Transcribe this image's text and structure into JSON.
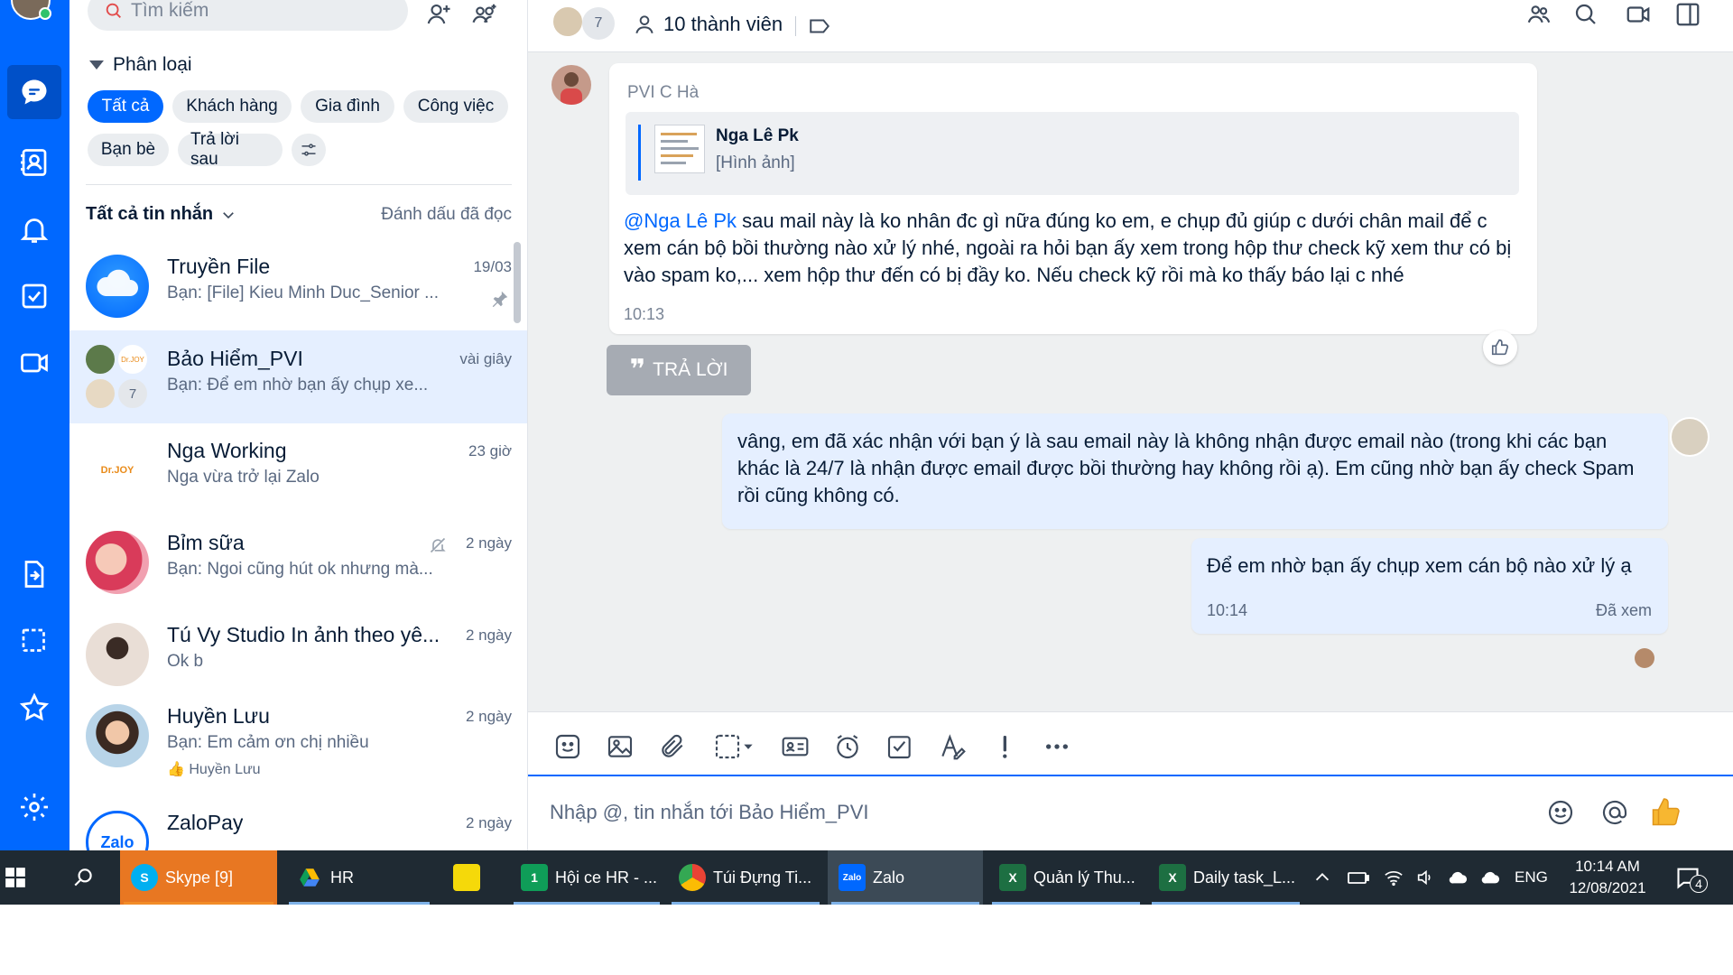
{
  "nav": {
    "items": [
      "chat-icon",
      "contacts-icon",
      "bell-icon",
      "todo-icon",
      "video-icon",
      "file-transfer-icon",
      "screenshot-icon",
      "star-icon",
      "settings-icon"
    ]
  },
  "sidebar": {
    "search_placeholder": "Tìm kiếm",
    "section_title": "Phân loại",
    "chips": [
      "Tất cả",
      "Khách hàng",
      "Gia đình",
      "Công việc",
      "Bạn bè",
      "Trả lời sau"
    ],
    "filter_label": "Tất cả tin nhắn",
    "mark_read": "Đánh dấu đã đọc",
    "conversations": [
      {
        "name": "Truyền File",
        "preview": "Bạn: [File] Kieu Minh Duc_Senior ...",
        "time": "19/03"
      },
      {
        "name": "Bảo Hiểm_PVI",
        "preview": "Bạn: Để em nhờ bạn ấy chụp xe...",
        "time": "vài giây",
        "member_count": "7"
      },
      {
        "name": "Nga Working",
        "preview": "Nga vừa trở lại Zalo",
        "time": "23 giờ"
      },
      {
        "name": "Bỉm sữa",
        "preview": "Bạn: Ngoi cũng hút ok nhưng mà...",
        "time": "2 ngày"
      },
      {
        "name": "Tú Vy Studio In ảnh theo yê...",
        "preview": "Ok b",
        "time": "2 ngày"
      },
      {
        "name": "Huyền Lưu",
        "preview": "Bạn: Em cảm ơn chị nhiều",
        "time": "2 ngày",
        "reaction": "👍 Huyền Lưu"
      },
      {
        "name": "ZaloPay",
        "preview": "",
        "time": "2 ngày"
      }
    ]
  },
  "chat": {
    "header": {
      "member_count": "7",
      "members_label": "10 thành viên"
    },
    "incoming": {
      "sender": "PVI C Hà",
      "quote_name": "Nga Lê Pk",
      "quote_type": "[Hình ảnh]",
      "mention": "@Nga Lê Pk",
      "text": " sau mail này là ko nhân đc gì nữa đúng ko em, e chụp đủ giúp c dưới chân mail để c xem cán bộ bồi thường nào xử lý nhé, ngoài ra hỏi bạn ấy xem trong hộp thư check kỹ xem thư có bị vào spam ko,... xem hộp thư đến có bị đầy ko. Nếu check kỹ rồi mà ko thấy báo lại c nhé",
      "time": "10:13"
    },
    "reply_label": "TRẢ LỜI",
    "outgoing": [
      {
        "text": "vâng, em đã xác nhận với bạn ý là sau email này là không nhận được email nào (trong khi các bạn khác là 24/7 là nhận được email được bồi thường hay không rồi ạ). Em cũng nhờ bạn ấy check Spam rồi cũng không có."
      },
      {
        "text": "Để em nhờ bạn ấy chụp xem cán bộ nào xử lý ạ",
        "time": "10:14",
        "status": "Đã xem"
      }
    ],
    "input_placeholder": "Nhập @, tin nhắn tới Bảo Hiểm_PVI"
  },
  "taskbar": {
    "apps": [
      {
        "label": "Skype [9]",
        "badge": "9"
      },
      {
        "label": "HR"
      },
      {
        "label": ""
      },
      {
        "label": "Hội ce HR - ...",
        "badge": "1"
      },
      {
        "label": "Túi Đựng Ti..."
      },
      {
        "label": "Zalo"
      },
      {
        "label": "Quản lý Thu..."
      },
      {
        "label": "Daily task_L..."
      }
    ],
    "lang": "ENG",
    "time": "10:14 AM",
    "date": "12/08/2021",
    "notif_count": "4"
  },
  "colors": {
    "accent": "#0068ff",
    "bubble_out": "#e5efff",
    "taskbar": "#1f2a33"
  }
}
